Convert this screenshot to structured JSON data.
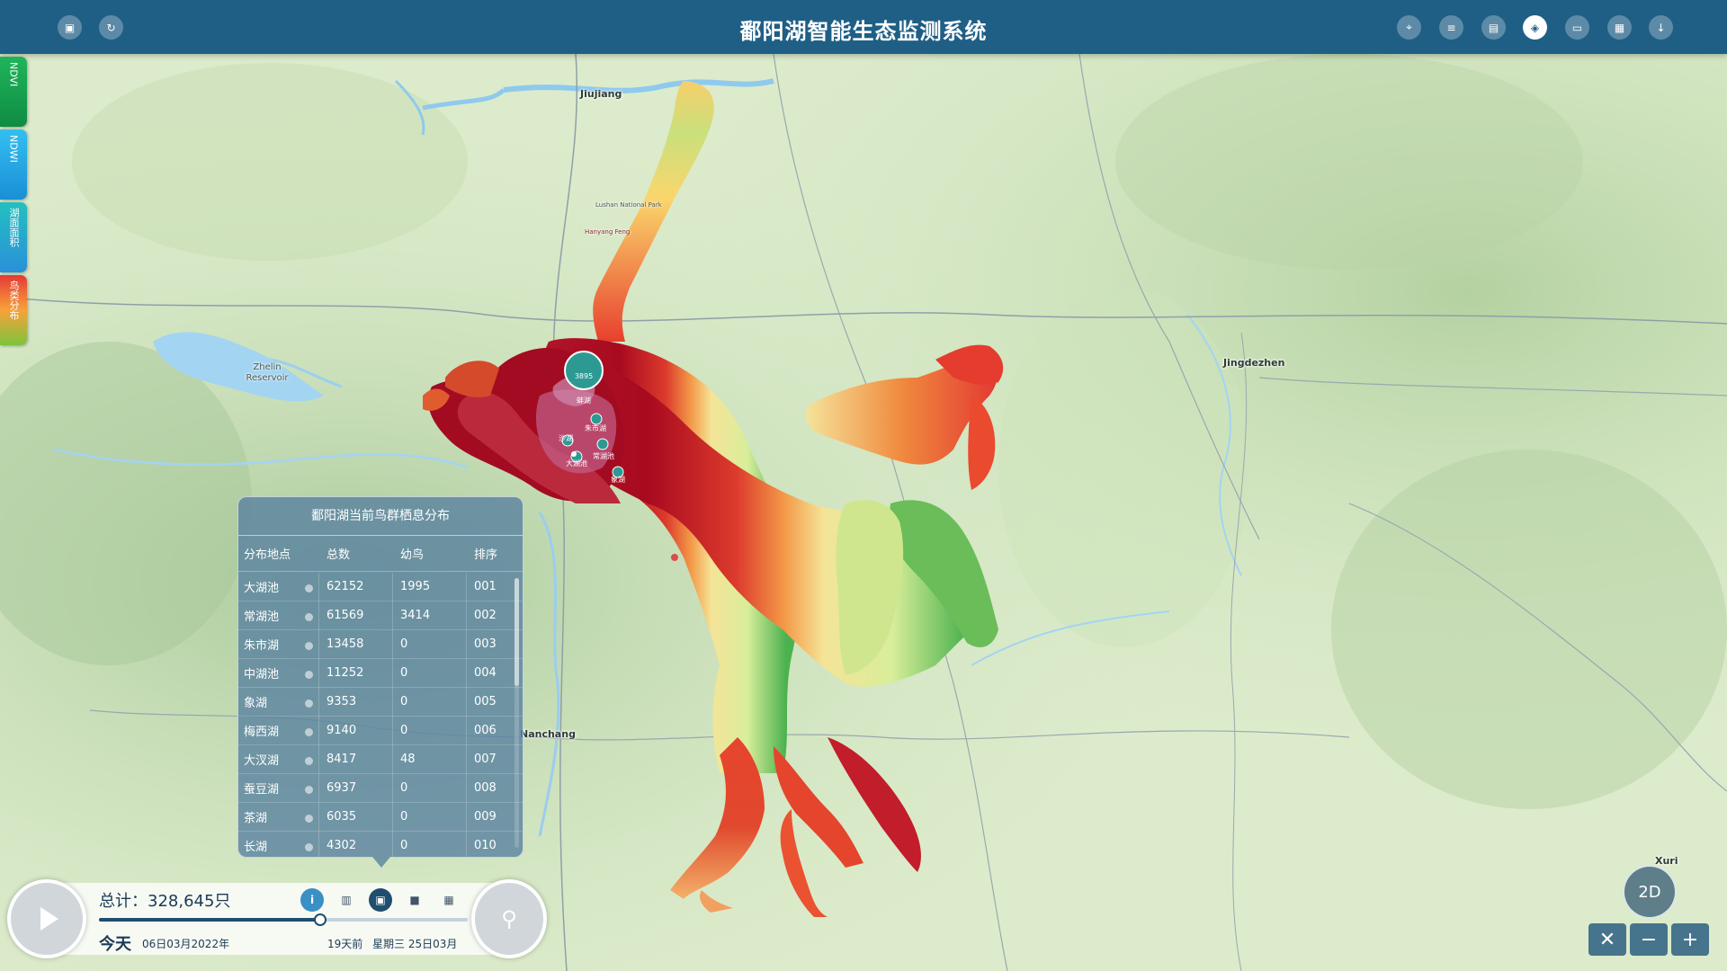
{
  "header": {
    "title": "鄱阳湖智能生态监测系统",
    "left_icons": [
      "document-icon",
      "refresh-icon"
    ],
    "right_icons": [
      "location-icon",
      "database-icon",
      "report-icon",
      "layers-icon",
      "monitor-icon",
      "chat-icon",
      "download-icon"
    ],
    "active_icon": "layers-icon"
  },
  "layer_tabs": [
    {
      "label": "NDVI",
      "color_top": "#1fb55a",
      "color_bottom": "#0f8c43"
    },
    {
      "label": "NDWI",
      "color_top": "#33bff0",
      "color_bottom": "#1a8fd6"
    },
    {
      "label": "湖面面积",
      "color_top": "#22c0c0",
      "color_bottom": "#2a90d9"
    },
    {
      "label": "鸟类分布",
      "color_top": "#e53935",
      "color_bottom": "#7cc43c"
    }
  ],
  "map": {
    "places": [
      "Jiujiang",
      "Jingdezhen",
      "Nanchang",
      "Zhelin Reservoir",
      "Xuri",
      "Lushan National Park",
      "Hanyang Feng"
    ],
    "cluster_count": "3895",
    "lake_labels": [
      "蚌湖",
      "朱市湖",
      "沙湖",
      "常湖池",
      "大湖池",
      "象湖"
    ],
    "heat_colors": [
      "#9b0a1e",
      "#d8342b",
      "#f07a3c",
      "#f8c860",
      "#eff39a",
      "#a8dc78",
      "#3fae4f"
    ]
  },
  "panel": {
    "title": "鄱阳湖当前鸟群栖息分布",
    "columns": [
      "分布地点",
      "总数",
      "幼鸟",
      "排序"
    ],
    "rows": [
      {
        "place": "大湖池",
        "total": "62152",
        "young": "1995",
        "rank": "001"
      },
      {
        "place": "常湖池",
        "total": "61569",
        "young": "3414",
        "rank": "002"
      },
      {
        "place": "朱市湖",
        "total": "13458",
        "young": "0",
        "rank": "003"
      },
      {
        "place": "中湖池",
        "total": "11252",
        "young": "0",
        "rank": "004"
      },
      {
        "place": "象湖",
        "total": "9353",
        "young": "0",
        "rank": "005"
      },
      {
        "place": "梅西湖",
        "total": "9140",
        "young": "0",
        "rank": "006"
      },
      {
        "place": "大汊湖",
        "total": "8417",
        "young": "48",
        "rank": "007"
      },
      {
        "place": "蚕豆湖",
        "total": "6937",
        "young": "0",
        "rank": "008"
      },
      {
        "place": "茶湖",
        "total": "6035",
        "young": "0",
        "rank": "009"
      },
      {
        "place": "长湖",
        "total": "4302",
        "young": "0",
        "rank": "010"
      }
    ]
  },
  "timeline": {
    "total": "总计：328,645只",
    "today": "今天",
    "date": "06日03月2022年",
    "ago": "19天前",
    "weekday": "星期三 25日03月",
    "progress": 0.6,
    "modes": [
      "info-icon",
      "list-icon",
      "map-icon",
      "square-icon",
      "book-icon"
    ],
    "active_mode": "map-icon"
  },
  "controls": {
    "view_mode": "2D",
    "zoom_in": "+",
    "zoom_out": "−",
    "reset": "✕"
  }
}
